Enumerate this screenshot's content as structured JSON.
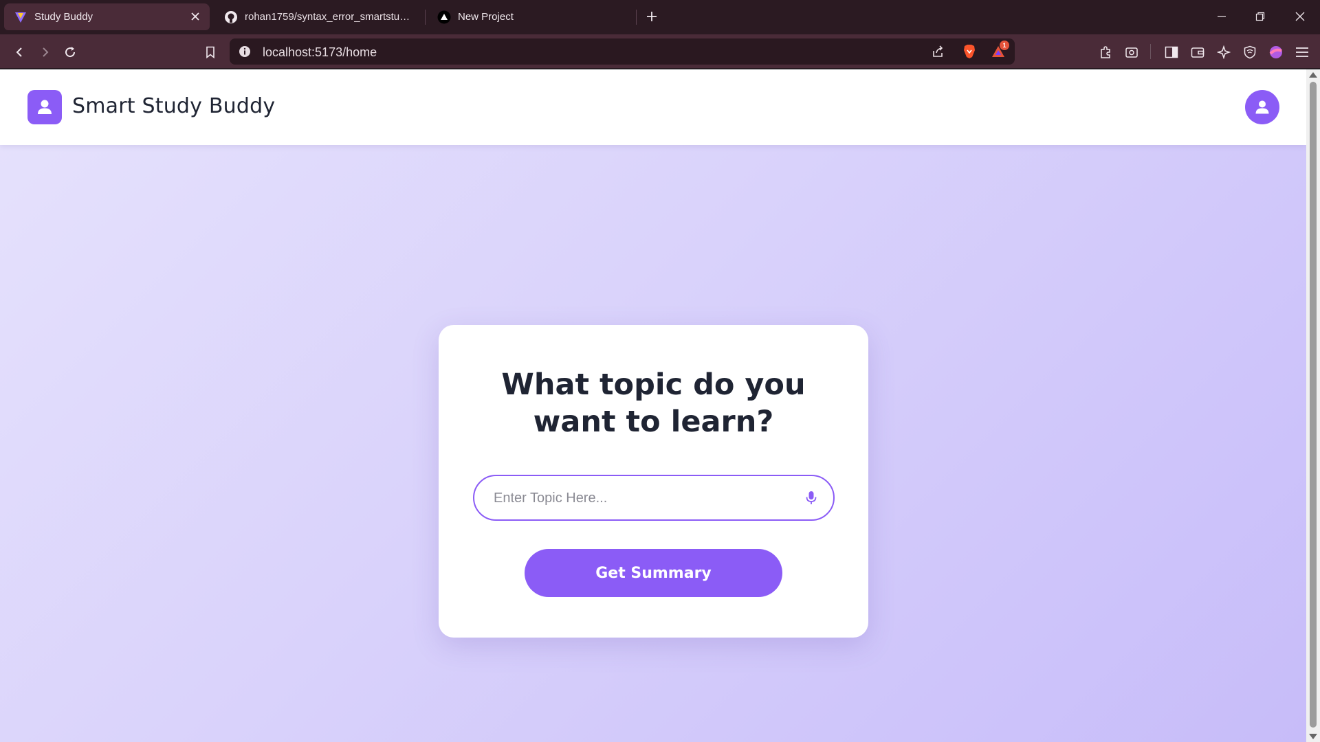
{
  "browser": {
    "tabs": [
      {
        "title": "Study Buddy",
        "active": true
      },
      {
        "title": "rohan1759/syntax_error_smartstudybuddy",
        "active": false
      },
      {
        "title": "New Project",
        "active": false
      }
    ],
    "url": "localhost:5173/home",
    "notification_count": "1"
  },
  "app": {
    "title": "Smart Study Buddy",
    "brand_color": "#8b5cf6"
  },
  "card": {
    "heading": "What topic do you want to learn?",
    "input_placeholder": "Enter Topic Here...",
    "input_value": "",
    "button_label": "Get Summary"
  },
  "icons": {
    "logo": "user-icon",
    "avatar": "user-icon",
    "input": "microphone-icon"
  }
}
